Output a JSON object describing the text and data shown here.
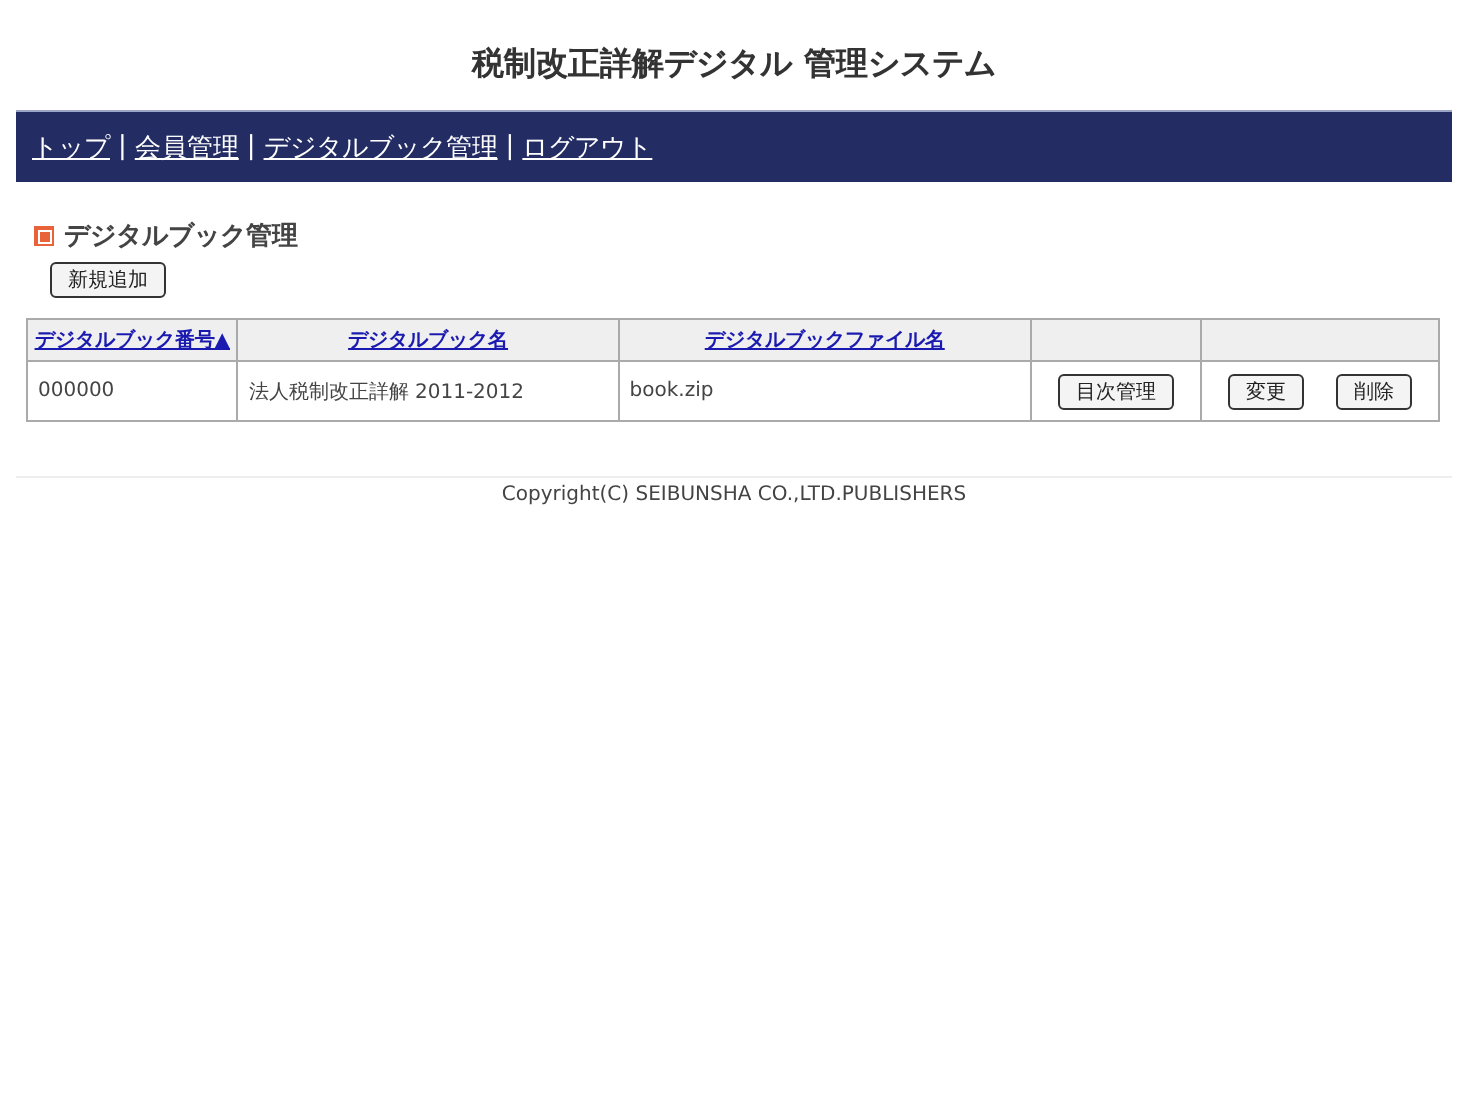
{
  "title": "税制改正詳解デジタル 管理システム",
  "nav": {
    "separator": "|",
    "links": [
      "トップ",
      "会員管理",
      "デジタルブック管理",
      "ログアウト"
    ]
  },
  "section": {
    "title": "デジタルブック管理",
    "add_button": "新規追加"
  },
  "table": {
    "columns": [
      "デジタルブック番号▲",
      "デジタルブック名",
      "デジタルブックファイル名",
      null,
      null
    ],
    "rows": [
      {
        "cells": [
          "000000",
          "法人税制改正詳解 2011-2012",
          "book.zip"
        ],
        "actions": [
          [
            "目次管理"
          ],
          [
            "変更",
            "削除"
          ]
        ]
      }
    ]
  },
  "footer": "Copyright(C) SEIBUNSHA CO.,LTD.PUBLISHERS"
}
